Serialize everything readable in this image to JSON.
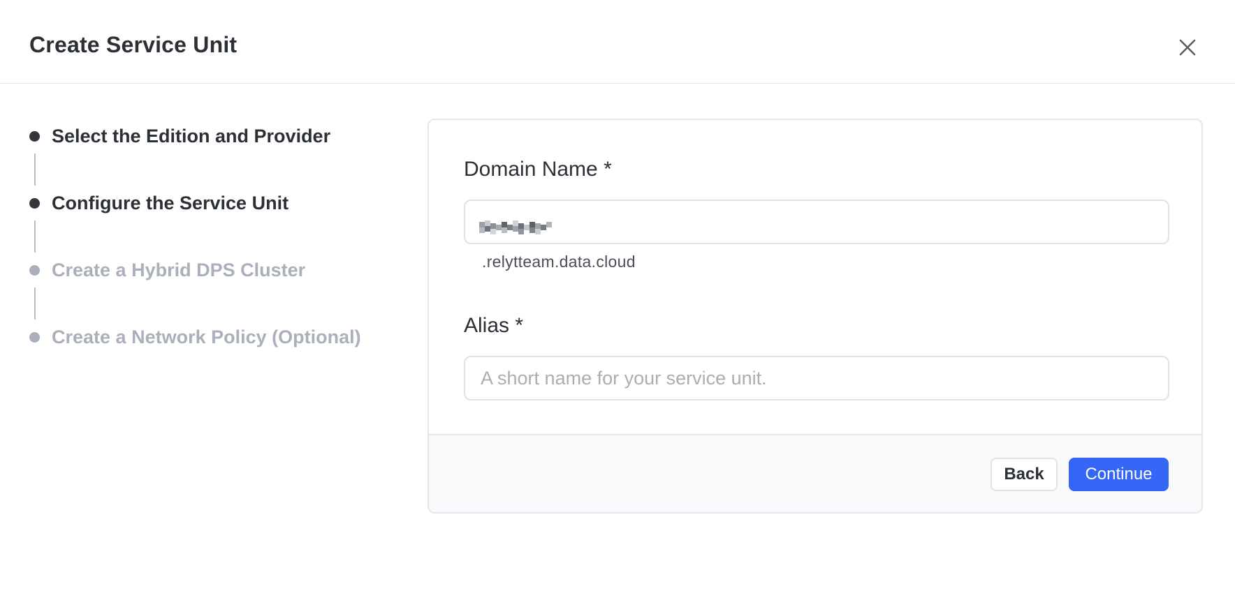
{
  "dialog": {
    "title": "Create Service Unit"
  },
  "stepper": {
    "steps": [
      {
        "label": "Select the Edition and Provider",
        "status": "done"
      },
      {
        "label": "Configure the Service Unit",
        "status": "done"
      },
      {
        "label": "Create a Hybrid DPS Cluster",
        "status": "pending"
      },
      {
        "label": "Create a Network Policy (Optional)",
        "status": "pending"
      }
    ]
  },
  "form": {
    "domain_name": {
      "label": "Domain Name *",
      "value": "",
      "suffix": ".relytteam.data.cloud"
    },
    "alias": {
      "label": "Alias *",
      "placeholder": "A short name for your service unit.",
      "value": ""
    }
  },
  "actions": {
    "back_label": "Back",
    "continue_label": "Continue"
  },
  "colors": {
    "primary": "#3566f6",
    "step_done": "#33373d",
    "step_pending": "#a9b0bb"
  },
  "icons": {
    "close": "close-icon"
  }
}
